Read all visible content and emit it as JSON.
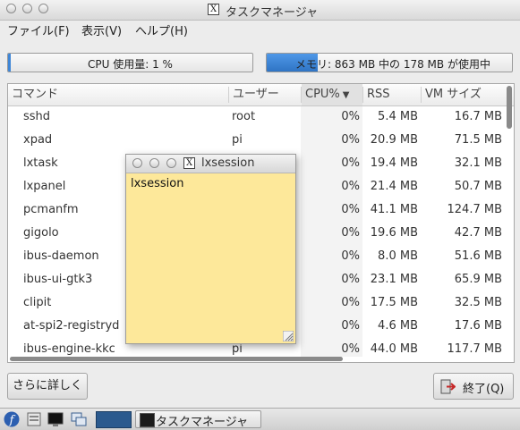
{
  "window": {
    "title": "タスクマネージャ"
  },
  "menu": {
    "file": "ファイル(F)",
    "view": "表示(V)",
    "help": "ヘルプ(H)"
  },
  "cpu_bar": {
    "label": "CPU 使用量: 1 %",
    "percent": 1
  },
  "memory_bar": {
    "label": "メモリ: 863 MB 中の 178 MB が使用中",
    "used_mb": 178,
    "total_mb": 863
  },
  "table": {
    "columns": {
      "command": "コマンド",
      "user": "ユーザー",
      "cpu": "CPU%",
      "rss": "RSS",
      "vm": "VM サイズ"
    },
    "rows": [
      {
        "command": "sshd",
        "user": "root",
        "cpu": "0%",
        "rss": "5.4 MB",
        "vm": "16.7 MB"
      },
      {
        "command": "xpad",
        "user": "pi",
        "cpu": "0%",
        "rss": "20.9 MB",
        "vm": "71.5 MB"
      },
      {
        "command": "lxtask",
        "user": "",
        "cpu": "0%",
        "rss": "19.4 MB",
        "vm": "32.1 MB"
      },
      {
        "command": "lxpanel",
        "user": "",
        "cpu": "0%",
        "rss": "21.4 MB",
        "vm": "50.7 MB"
      },
      {
        "command": "pcmanfm",
        "user": "",
        "cpu": "0%",
        "rss": "41.1 MB",
        "vm": "124.7 MB"
      },
      {
        "command": "gigolo",
        "user": "",
        "cpu": "0%",
        "rss": "19.6 MB",
        "vm": "42.7 MB"
      },
      {
        "command": "ibus-daemon",
        "user": "",
        "cpu": "0%",
        "rss": "8.0 MB",
        "vm": "51.6 MB"
      },
      {
        "command": "ibus-ui-gtk3",
        "user": "",
        "cpu": "0%",
        "rss": "23.1 MB",
        "vm": "65.9 MB"
      },
      {
        "command": "clipit",
        "user": "",
        "cpu": "0%",
        "rss": "17.5 MB",
        "vm": "32.5 MB"
      },
      {
        "command": "at-spi2-registryd",
        "user": "",
        "cpu": "0%",
        "rss": "4.6 MB",
        "vm": "17.6 MB"
      },
      {
        "command": "ibus-engine-kkc",
        "user": "pi",
        "cpu": "0%",
        "rss": "44.0 MB",
        "vm": "117.7 MB"
      }
    ]
  },
  "buttons": {
    "more": "さらに詳しく",
    "quit": "終了(Q)"
  },
  "taskbar": {
    "task_label": "タスクマネージャ"
  },
  "overlay_window": {
    "title": "lxsession",
    "body": "lxsession"
  },
  "colors": {
    "accent": "#3f86d6",
    "note_bg": "#fde89a"
  }
}
